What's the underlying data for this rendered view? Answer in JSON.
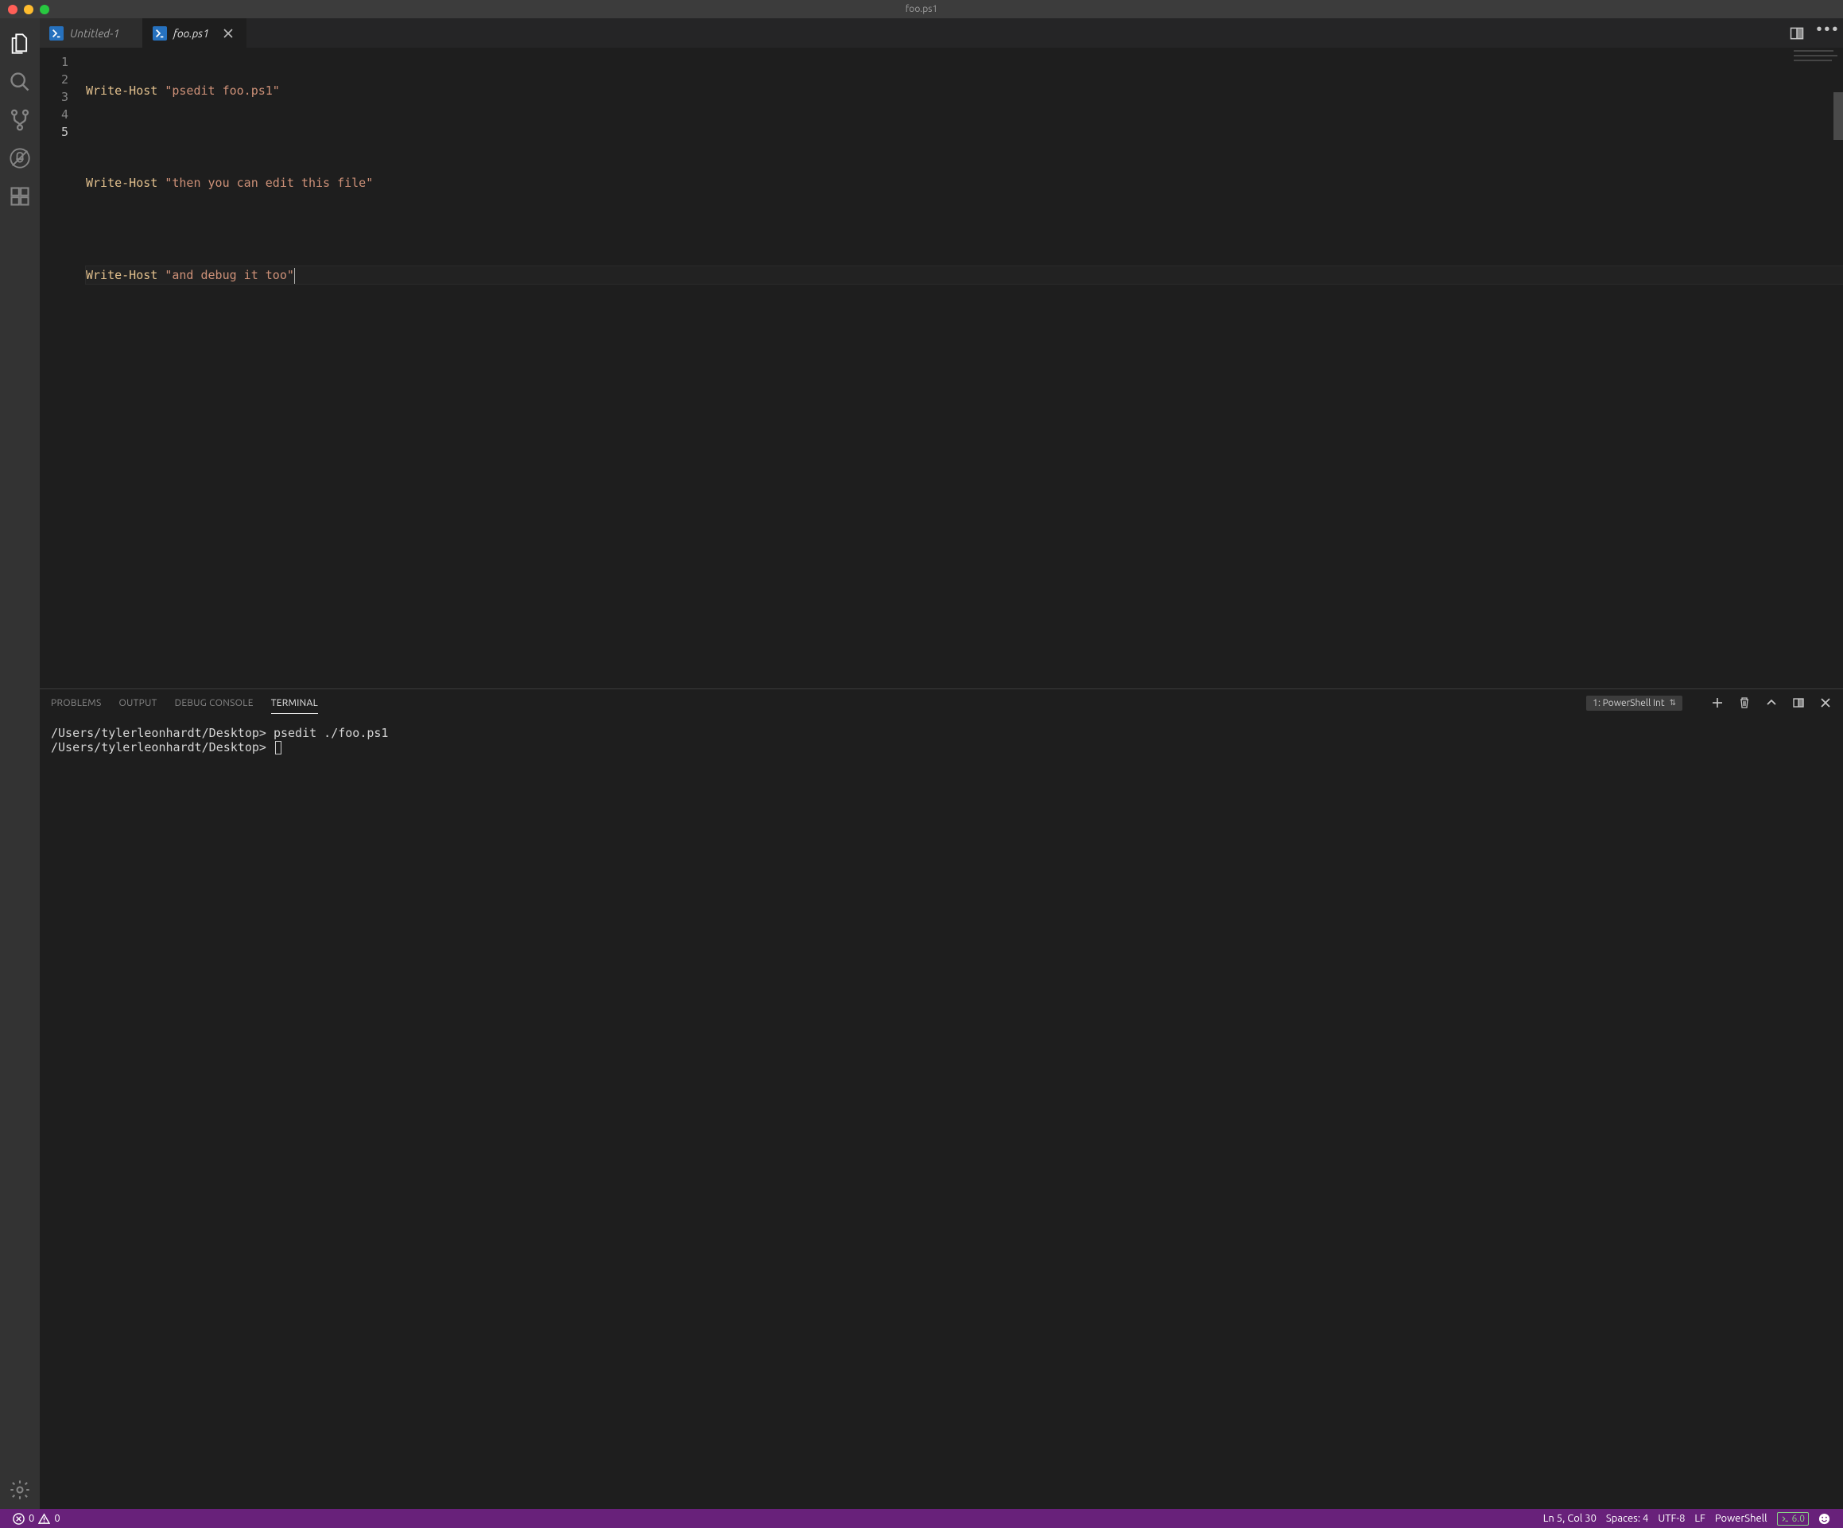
{
  "window": {
    "title": "foo.ps1"
  },
  "tabs": [
    {
      "label": "Untitled-1",
      "icon": "powershell",
      "active": false,
      "dirty": false
    },
    {
      "label": "foo.ps1",
      "icon": "powershell",
      "active": true,
      "dirty": false
    }
  ],
  "editor": {
    "language": "powershell",
    "current_line": 5,
    "lines": [
      {
        "n": 1,
        "cmd": "Write-Host",
        "str": "\"psedit foo.ps1\""
      },
      {
        "n": 2,
        "cmd": "",
        "str": ""
      },
      {
        "n": 3,
        "cmd": "Write-Host",
        "str": "\"then you can edit this file\""
      },
      {
        "n": 4,
        "cmd": "",
        "str": ""
      },
      {
        "n": 5,
        "cmd": "Write-Host",
        "str": "\"and debug it too\""
      }
    ]
  },
  "panel": {
    "tabs": {
      "problems": "PROBLEMS",
      "output": "OUTPUT",
      "debug": "DEBUG CONSOLE",
      "terminal": "TERMINAL"
    },
    "terminal_picker": "1: PowerShell Int",
    "terminal_lines": [
      "/Users/tylerleonhardt/Desktop> psedit ./foo.ps1",
      "/Users/tylerleonhardt/Desktop> "
    ]
  },
  "status": {
    "errors": "0",
    "warnings": "0",
    "cursor": "Ln 5, Col 30",
    "indent": "Spaces: 4",
    "encoding": "UTF-8",
    "eol": "LF",
    "language": "PowerShell",
    "ps_version": "6.0"
  }
}
